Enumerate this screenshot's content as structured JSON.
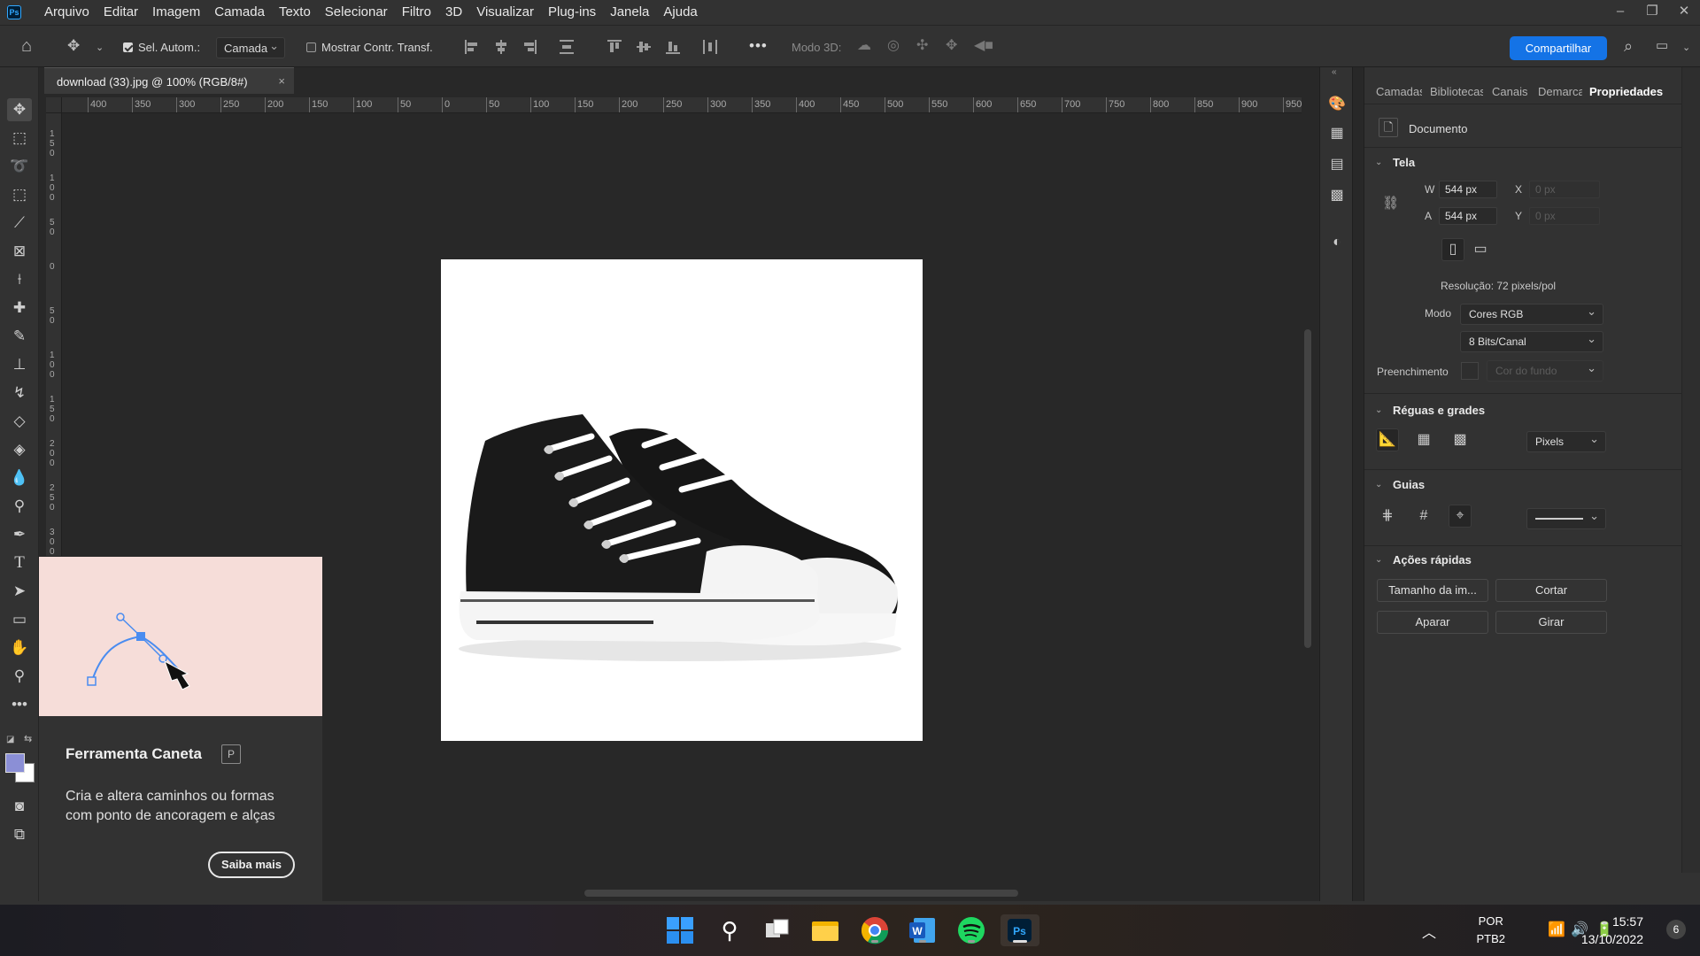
{
  "menubar": {
    "logo": "Ps",
    "items": [
      "Arquivo",
      "Editar",
      "Imagem",
      "Camada",
      "Texto",
      "Selecionar",
      "Filtro",
      "3D",
      "Visualizar",
      "Plug-ins",
      "Janela",
      "Ajuda"
    ]
  },
  "options": {
    "auto_select_label": "Sel. Autom.:",
    "auto_select_checked": true,
    "layer_select": "Camada",
    "show_transform_label": "Mostrar Contr. Transf.",
    "show_transform_checked": false,
    "more": "•••",
    "mode3d_label": "Modo 3D:",
    "share_label": "Compartilhar"
  },
  "document_tab": {
    "title": "download (33).jpg @ 100% (RGB/8#)",
    "close": "×"
  },
  "ruler": {
    "horizontal": [
      "400",
      "350",
      "300",
      "250",
      "200",
      "150",
      "100",
      "50",
      "0",
      "50",
      "100",
      "150",
      "200",
      "250",
      "300",
      "350",
      "400",
      "450",
      "500",
      "550",
      "600",
      "650",
      "700",
      "750",
      "800",
      "850",
      "900",
      "950"
    ],
    "vertical": [
      "150",
      "100",
      "50",
      "0",
      "50",
      "100",
      "150",
      "200",
      "250",
      "300"
    ]
  },
  "tooltip": {
    "title": "Ferramenta Caneta",
    "shortcut": "P",
    "description": "Cria e altera caminhos ou formas com ponto de ancoragem e alças",
    "learn_more": "Saiba mais"
  },
  "panel": {
    "tabs": [
      "Camadas",
      "Bibliotecas",
      "Canais",
      "Demarcadores",
      "Propriedades"
    ],
    "active_tab": "Propriedades",
    "document_label": "Documento",
    "canvas_section": "Tela",
    "width_label": "W",
    "width_value": "544 px",
    "height_label": "A",
    "height_value": "544 px",
    "x_label": "X",
    "x_placeholder": "0 px",
    "y_label": "Y",
    "y_placeholder": "0 px",
    "resolution": "Resolução: 72 pixels/pol",
    "mode_label": "Modo",
    "mode_value": "Cores RGB",
    "bits_value": "8 Bits/Canal",
    "fill_label": "Preenchimento",
    "fill_value": "Cor do fundo",
    "rulers_section": "Réguas e grades",
    "units_value": "Pixels",
    "guides_section": "Guias",
    "quick_section": "Ações rápidas",
    "quick_actions": [
      "Tamanho da im...",
      "Cortar",
      "Aparar",
      "Girar"
    ]
  },
  "taskbar": {
    "apps": [
      "start",
      "search",
      "task-view",
      "file-explorer",
      "chrome",
      "word",
      "spotify",
      "photoshop"
    ],
    "lang_line1": "POR",
    "lang_line2": "PTB2",
    "time": "15:57",
    "date": "13/10/2022",
    "notifications": "6"
  },
  "colors": {
    "accent": "#1473e6",
    "foreground": "#8b8fd6",
    "background": "#ffffff"
  }
}
